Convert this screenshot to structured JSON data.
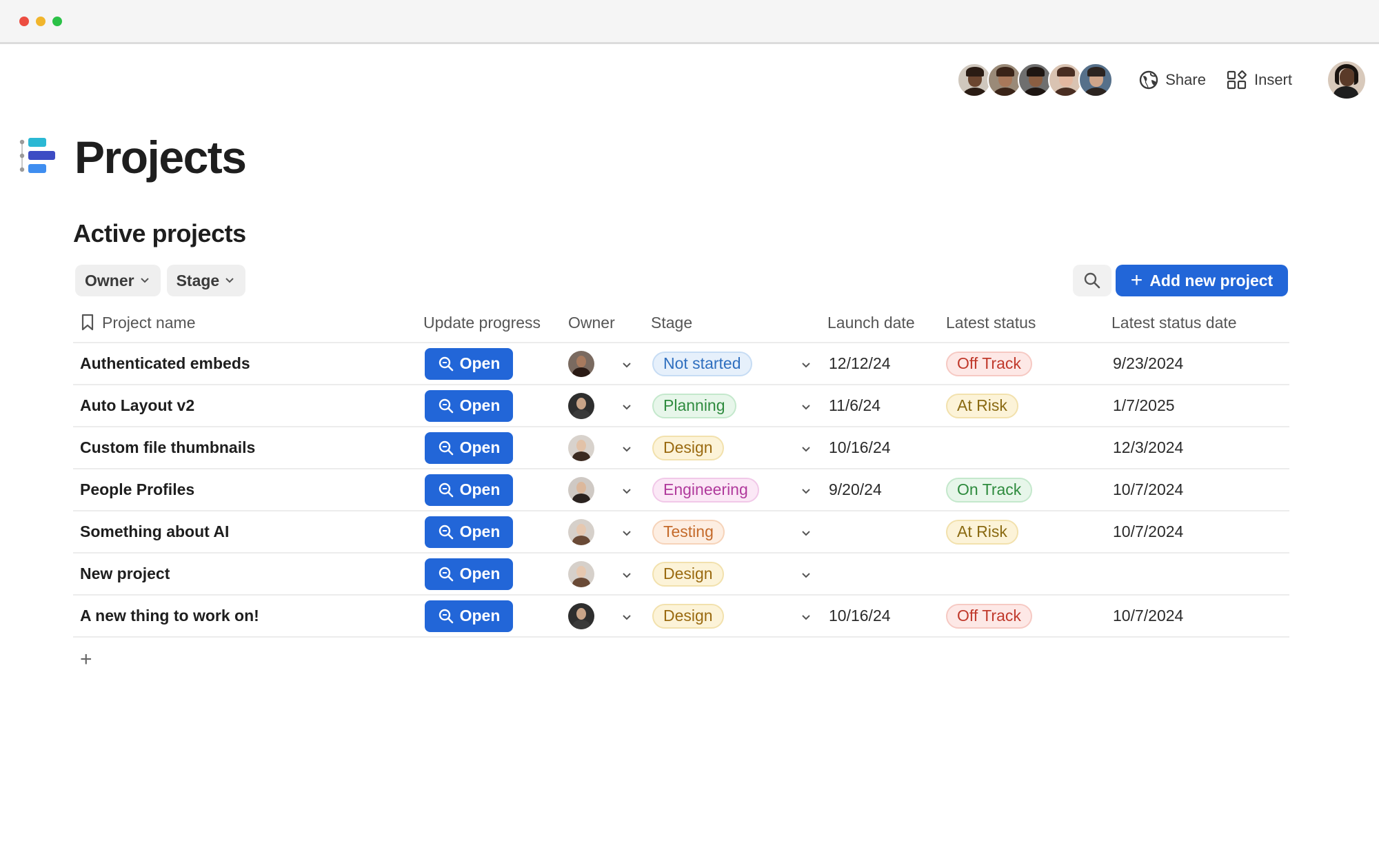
{
  "window": {
    "controls": [
      "close",
      "minimize",
      "zoom"
    ]
  },
  "topbar": {
    "collaborators": [
      {
        "name": "collaborator-1",
        "skin": "#6b4630",
        "bg": "#cfc7bd",
        "hair": "#2a1c14"
      },
      {
        "name": "collaborator-2",
        "skin": "#a8785a",
        "bg": "#9a8a78",
        "hair": "#3a2418"
      },
      {
        "name": "collaborator-3",
        "skin": "#8a5e42",
        "bg": "#6f6f6f",
        "hair": "#1e1612"
      },
      {
        "name": "collaborator-4",
        "skin": "#e4b8a0",
        "bg": "#d9c3b2",
        "hair": "#4a2e22"
      },
      {
        "name": "collaborator-5",
        "skin": "#cfa58a",
        "bg": "#56708a",
        "hair": "#2c2420"
      }
    ],
    "share_label": "Share",
    "insert_label": "Insert"
  },
  "doc": {
    "title": "Projects"
  },
  "section": {
    "title": "Active projects"
  },
  "filters": [
    {
      "label": "Owner"
    },
    {
      "label": "Stage"
    }
  ],
  "toolbar": {
    "add_label": "Add new project"
  },
  "table": {
    "columns": [
      "Project name",
      "Update progress",
      "Owner",
      "Stage",
      "Launch date",
      "Latest status",
      "Latest status date"
    ],
    "rows": [
      {
        "name": "Authenticated embeds",
        "button": "Open",
        "owner_skin": "#a87a5e",
        "owner_hair": "#2a1a14",
        "owner_bg": "#7a6a60",
        "stage": "Not started",
        "stage_color": "#2f6fbf",
        "stage_bg": "#e6f0fb",
        "stage_border": "#c6dcf4",
        "launch": "12/12/24",
        "status": "Off Track",
        "status_color": "#c0392b",
        "status_bg": "#fde8e6",
        "status_border": "#f6c9c3",
        "status_date": "9/23/2024"
      },
      {
        "name": "Auto Layout v2",
        "button": "Open",
        "owner_skin": "#c9a488",
        "owner_hair": "#3a3a3a",
        "owner_bg": "#2e2e2e",
        "stage": "Planning",
        "stage_color": "#2e8b3e",
        "stage_bg": "#e7f6ea",
        "stage_border": "#c4e8cc",
        "launch": "11/6/24",
        "status": "At Risk",
        "status_color": "#8a6a12",
        "status_bg": "#fcf3d8",
        "status_border": "#f2e1ad",
        "status_date": "1/7/2025"
      },
      {
        "name": "Custom file thumbnails",
        "button": "Open",
        "owner_skin": "#e2c2a8",
        "owner_hair": "#3b2a20",
        "owner_bg": "#d8d2cc",
        "stage": "Design",
        "stage_color": "#9a6a10",
        "stage_bg": "#fcf3d8",
        "stage_border": "#f2e1ad",
        "launch": "10/16/24",
        "status": "",
        "status_color": "",
        "status_bg": "",
        "status_border": "",
        "status_date": "12/3/2024"
      },
      {
        "name": "People Profiles",
        "button": "Open",
        "owner_skin": "#dcb89c",
        "owner_hair": "#2b2320",
        "owner_bg": "#cfc9c4",
        "stage": "Engineering",
        "stage_color": "#b03a9c",
        "stage_bg": "#fbe8f6",
        "stage_border": "#f1c8e8",
        "launch": "9/20/24",
        "status": "On Track",
        "status_color": "#2e8b3e",
        "status_bg": "#e7f6ea",
        "status_border": "#c4e8cc",
        "status_date": "10/7/2024"
      },
      {
        "name": "Something about AI",
        "button": "Open",
        "owner_skin": "#e6c8b0",
        "owner_hair": "#6a4a36",
        "owner_bg": "#d6d0ca",
        "stage": "Testing",
        "stage_color": "#c46a2a",
        "stage_bg": "#fdeee2",
        "stage_border": "#f6d3b9",
        "launch": "",
        "status": "At Risk",
        "status_color": "#8a6a12",
        "status_bg": "#fcf3d8",
        "status_border": "#f2e1ad",
        "status_date": "10/7/2024"
      },
      {
        "name": "New project",
        "button": "Open",
        "owner_skin": "#e6c8b0",
        "owner_hair": "#6a4a36",
        "owner_bg": "#d6d0ca",
        "stage": "Design",
        "stage_color": "#9a6a10",
        "stage_bg": "#fcf3d8",
        "stage_border": "#f2e1ad",
        "launch": "",
        "status": "",
        "status_color": "",
        "status_bg": "",
        "status_border": "",
        "status_date": ""
      },
      {
        "name": "A new thing to work on!",
        "button": "Open",
        "owner_skin": "#c9a488",
        "owner_hair": "#3a3a3a",
        "owner_bg": "#2e2e2e",
        "stage": "Design",
        "stage_color": "#9a6a10",
        "stage_bg": "#fcf3d8",
        "stage_border": "#f2e1ad",
        "launch": "10/16/24",
        "status": "Off Track",
        "status_color": "#c0392b",
        "status_bg": "#fde8e6",
        "status_border": "#f6c9c3",
        "status_date": "10/7/2024"
      }
    ],
    "add_row_label": "+"
  },
  "colors": {
    "accent": "#2266d8",
    "border": "#ececec",
    "chip_bg": "#efefef"
  }
}
